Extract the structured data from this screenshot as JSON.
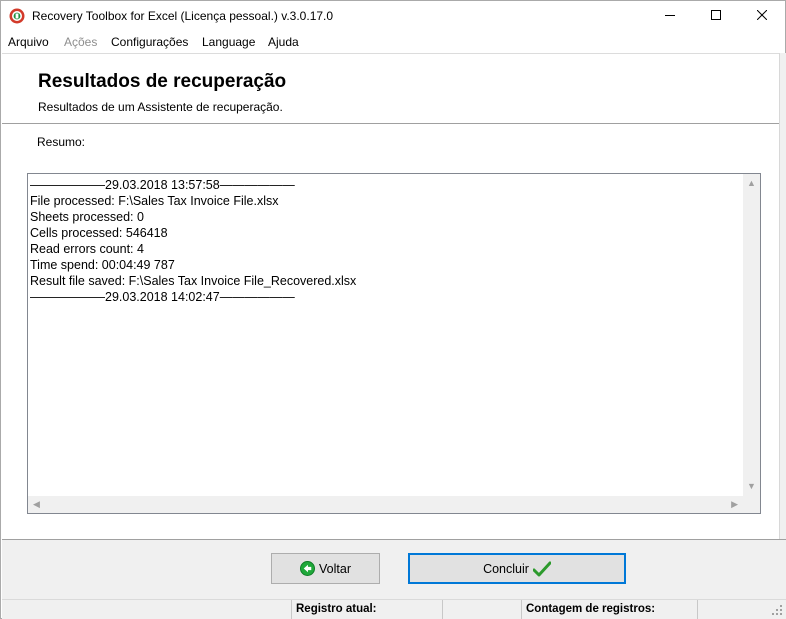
{
  "window": {
    "title": "Recovery Toolbox for Excel (Licença pessoal.) v.3.0.17.0"
  },
  "menu": {
    "items": [
      {
        "label": "Arquivo",
        "enabled": true
      },
      {
        "label": "Ações",
        "enabled": false
      },
      {
        "label": "Configurações",
        "enabled": true
      },
      {
        "label": "Language",
        "enabled": true
      },
      {
        "label": "Ajuda",
        "enabled": true
      }
    ]
  },
  "header": {
    "title": "Resultados de recuperação",
    "subtitle": "Resultados de um Assistente de recuperação."
  },
  "content": {
    "summary_label": "Resumo:",
    "log": [
      "——————29.03.2018 13:57:58——————",
      "File processed: F:\\Sales Tax Invoice File.xlsx",
      "Sheets processed: 0",
      "Cells processed: 546418",
      "Read errors count: 4",
      "Time spend: 00:04:49 787",
      "Result file saved: F:\\Sales Tax Invoice File_Recovered.xlsx",
      "——————29.03.2018 14:02:47——————"
    ]
  },
  "buttons": {
    "back_label": "Voltar",
    "finish_label": "Concluir"
  },
  "status": {
    "current_record_label": "Registro atual:",
    "record_count_label": "Contagem de registros:"
  },
  "icons": {
    "app": "app-logo-icon",
    "back": "back-arrow-icon",
    "finish": "checkmark-icon"
  },
  "colors": {
    "focus_border": "#0078d7",
    "back_icon_green": "#1fa83a",
    "check_green": "#2c9a2c"
  }
}
